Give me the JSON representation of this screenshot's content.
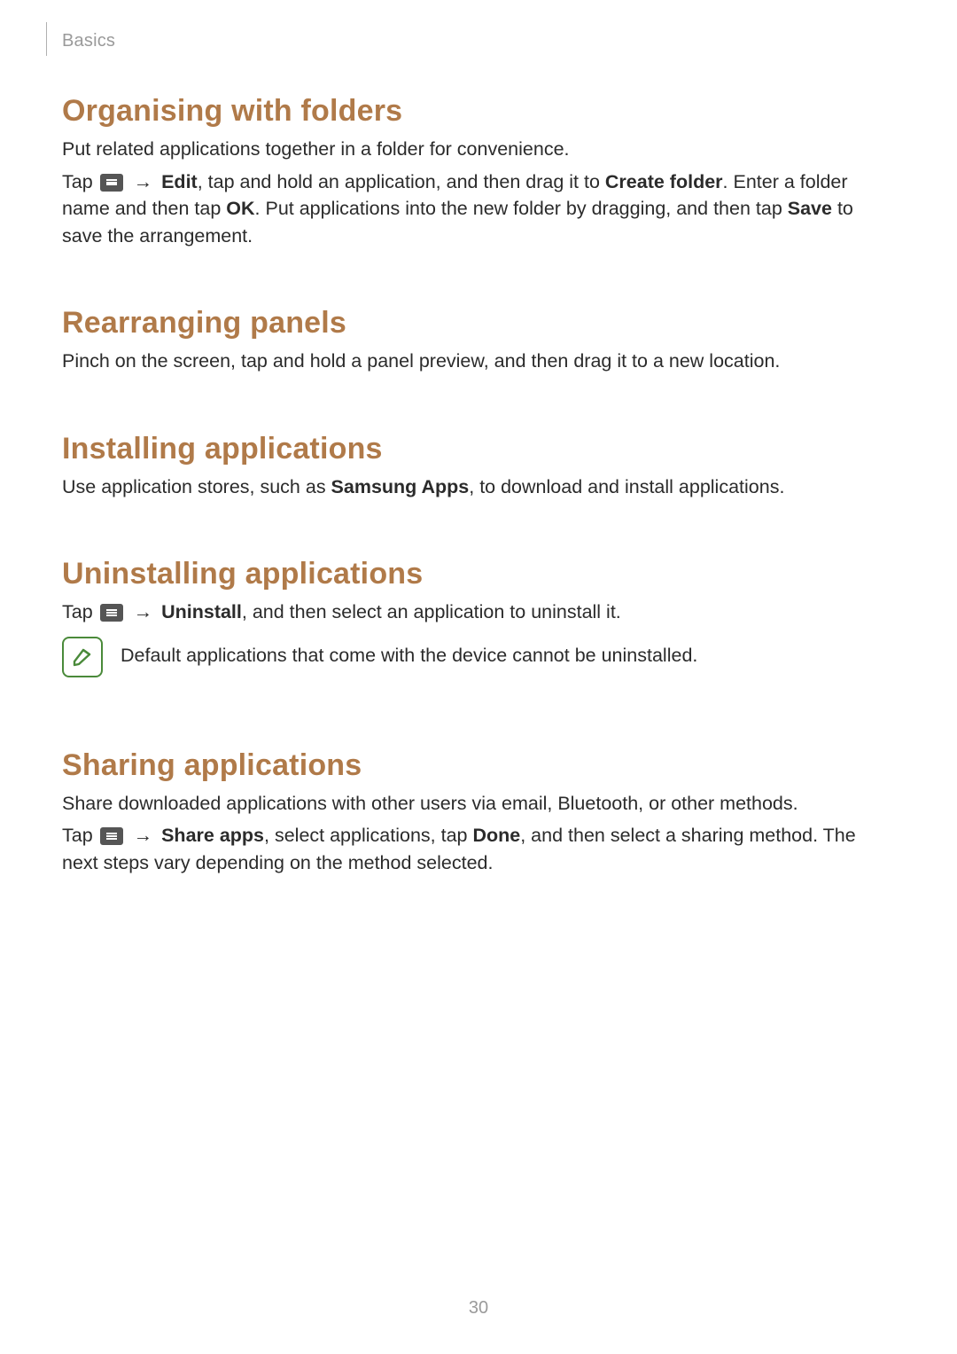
{
  "header": {
    "section": "Basics"
  },
  "page_number": "30",
  "icons": {
    "menu": "menu-icon",
    "note": "note-icon"
  },
  "sections": {
    "organising": {
      "title": "Organising with folders",
      "p1": "Put related applications together in a folder for convenience.",
      "p2a": "Tap ",
      "p2_arrow": " → ",
      "p2_edit": "Edit",
      "p2b": ", tap and hold an application, and then drag it to ",
      "p2_create": "Create folder",
      "p2c": ". Enter a folder name and then tap ",
      "p2_ok": "OK",
      "p2d": ". Put applications into the new folder by dragging, and then tap ",
      "p2_save": "Save",
      "p2e": " to save the arrangement."
    },
    "rearranging": {
      "title": "Rearranging panels",
      "p1": "Pinch on the screen, tap and hold a panel preview, and then drag it to a new location."
    },
    "installing": {
      "title": "Installing applications",
      "p1a": "Use application stores, such as ",
      "p1_apps": "Samsung Apps",
      "p1b": ", to download and install applications."
    },
    "uninstalling": {
      "title": "Uninstalling applications",
      "p1a": "Tap ",
      "p1_arrow": " → ",
      "p1_uninstall": "Uninstall",
      "p1b": ", and then select an application to uninstall it.",
      "note": "Default applications that come with the device cannot be uninstalled."
    },
    "sharing": {
      "title": "Sharing applications",
      "p1": "Share downloaded applications with other users via email, Bluetooth, or other methods.",
      "p2a": "Tap ",
      "p2_arrow": " → ",
      "p2_share": "Share apps",
      "p2b": ", select applications, tap ",
      "p2_done": "Done",
      "p2c": ", and then select a sharing method. The next steps vary depending on the method selected."
    }
  }
}
